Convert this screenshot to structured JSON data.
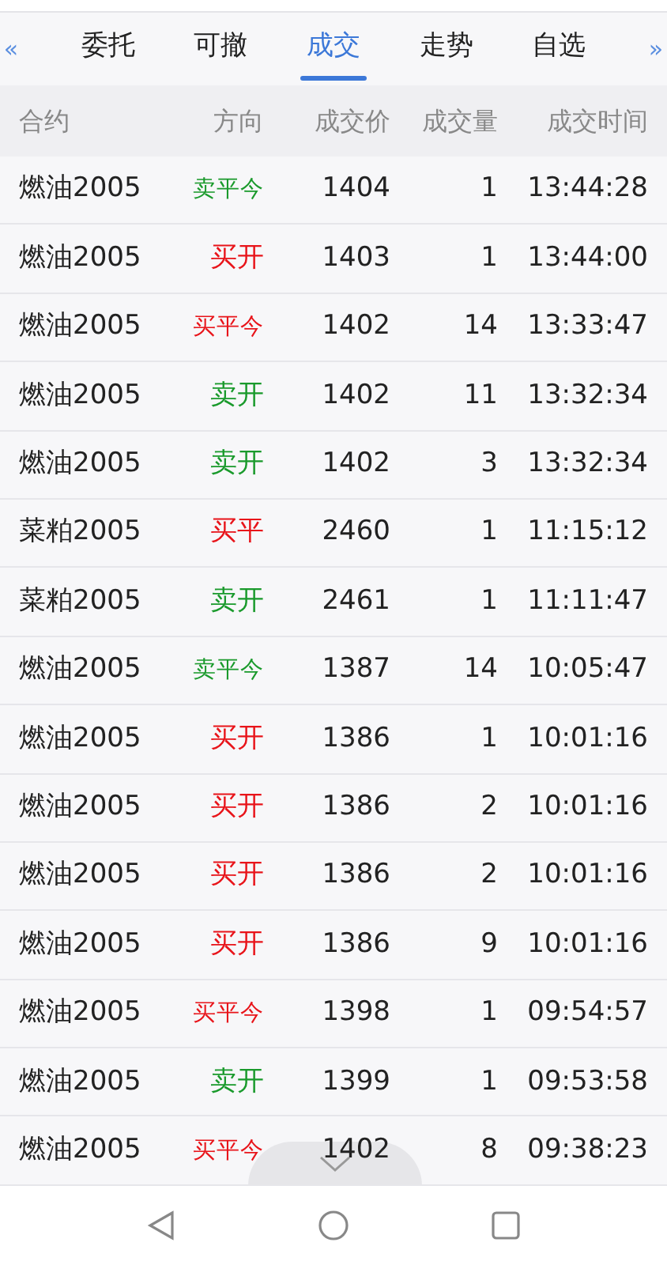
{
  "tab_scroll": {
    "left": "«",
    "right": "»"
  },
  "tabs": [
    {
      "label": "委托",
      "selected": false
    },
    {
      "label": "可撤",
      "selected": false
    },
    {
      "label": "成交",
      "selected": true
    },
    {
      "label": "走势",
      "selected": false
    },
    {
      "label": "自选",
      "selected": false
    }
  ],
  "table": {
    "columns": [
      "合约",
      "方向",
      "成交价",
      "成交量",
      "成交时间"
    ],
    "rows": [
      {
        "contract": "燃油2005",
        "direction": "卖平今",
        "color": "#1a9a2c",
        "price": "1404",
        "volume": "1",
        "time": "13:44:28"
      },
      {
        "contract": "燃油2005",
        "direction": "买开",
        "color": "#e8141a",
        "price": "1403",
        "volume": "1",
        "time": "13:44:00"
      },
      {
        "contract": "燃油2005",
        "direction": "买平今",
        "color": "#e8141a",
        "price": "1402",
        "volume": "14",
        "time": "13:33:47"
      },
      {
        "contract": "燃油2005",
        "direction": "卖开",
        "color": "#1a9a2c",
        "price": "1402",
        "volume": "11",
        "time": "13:32:34"
      },
      {
        "contract": "燃油2005",
        "direction": "卖开",
        "color": "#1a9a2c",
        "price": "1402",
        "volume": "3",
        "time": "13:32:34"
      },
      {
        "contract": "菜粕2005",
        "direction": "买平",
        "color": "#e8141a",
        "price": "2460",
        "volume": "1",
        "time": "11:15:12"
      },
      {
        "contract": "菜粕2005",
        "direction": "卖开",
        "color": "#1a9a2c",
        "price": "2461",
        "volume": "1",
        "time": "11:11:47"
      },
      {
        "contract": "燃油2005",
        "direction": "卖平今",
        "color": "#1a9a2c",
        "price": "1387",
        "volume": "14",
        "time": "10:05:47"
      },
      {
        "contract": "燃油2005",
        "direction": "买开",
        "color": "#e8141a",
        "price": "1386",
        "volume": "1",
        "time": "10:01:16"
      },
      {
        "contract": "燃油2005",
        "direction": "买开",
        "color": "#e8141a",
        "price": "1386",
        "volume": "2",
        "time": "10:01:16"
      },
      {
        "contract": "燃油2005",
        "direction": "买开",
        "color": "#e8141a",
        "price": "1386",
        "volume": "2",
        "time": "10:01:16"
      },
      {
        "contract": "燃油2005",
        "direction": "买开",
        "color": "#e8141a",
        "price": "1386",
        "volume": "9",
        "time": "10:01:16"
      },
      {
        "contract": "燃油2005",
        "direction": "买平今",
        "color": "#e8141a",
        "price": "1398",
        "volume": "1",
        "time": "09:54:57"
      },
      {
        "contract": "燃油2005",
        "direction": "卖开",
        "color": "#1a9a2c",
        "price": "1399",
        "volume": "1",
        "time": "09:53:58"
      },
      {
        "contract": "燃油2005",
        "direction": "买平今",
        "color": "#e8141a",
        "price": "1402",
        "volume": "8",
        "time": "09:38:23"
      }
    ]
  }
}
